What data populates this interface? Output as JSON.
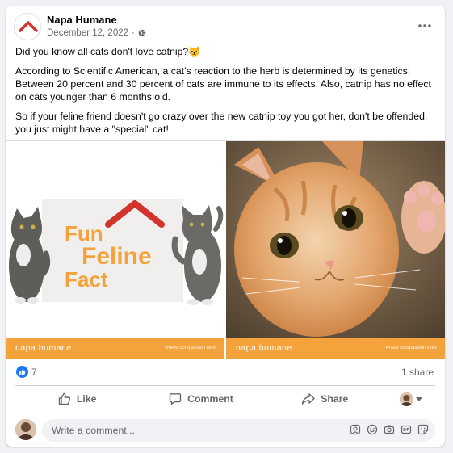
{
  "post": {
    "page_name": "Napa Humane",
    "date": "December 12, 2022",
    "privacy_sep": "·",
    "paragraphs": [
      "Did you know all cats don't love catnip?😾",
      "According to Scientific American, a cat’s reaction to the herb is determined by its genetics: Between 20 percent and 30 percent of cats are immune to its effects. Also, catnip has no effect on cats younger than 6 months old.",
      "So if your feline friend doesn't go crazy over the new catnip toy you got her, don't be offended, you just might have a \"special\" cat!"
    ]
  },
  "photos": {
    "left": {
      "line1": "Fun",
      "line2": "Feline",
      "line3": "Fact",
      "brand": "napa humane",
      "tag": "where compassion lives"
    },
    "right": {
      "brand": "napa humane",
      "tag": "where compassion lives"
    }
  },
  "stats": {
    "likes": "7",
    "shares": "1 share"
  },
  "actions": {
    "like": "Like",
    "comment": "Comment",
    "share": "Share"
  },
  "comment": {
    "placeholder": "Write a comment..."
  },
  "colors": {
    "accent": "#1877f2",
    "brand_orange": "#f4a23b",
    "logo_red": "#d4322c"
  }
}
